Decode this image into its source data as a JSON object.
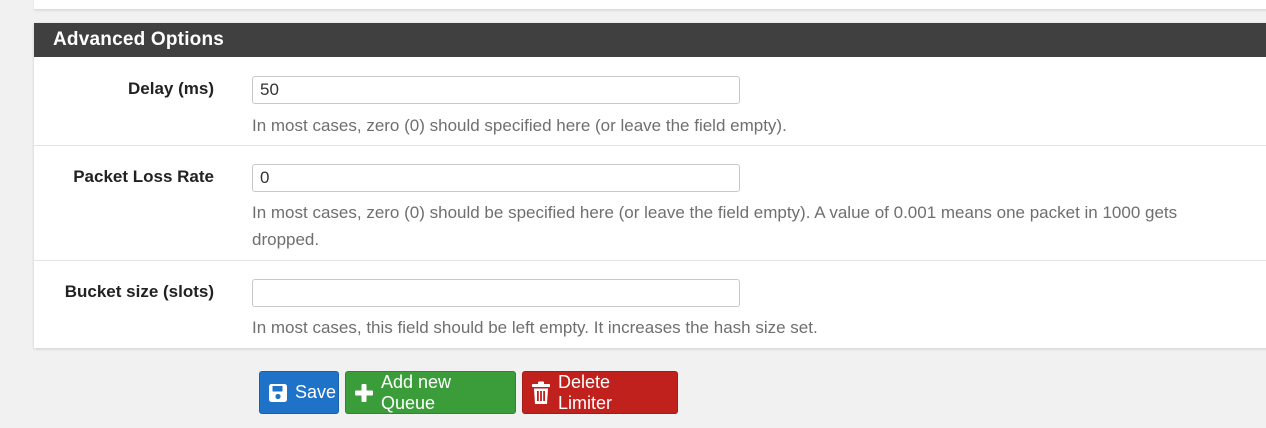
{
  "panel": {
    "title": "Advanced Options"
  },
  "fields": [
    {
      "label": "Delay (ms)",
      "value": "50",
      "help": "In most cases, zero (0) should specified here (or leave the field empty).",
      "help_line2": ""
    },
    {
      "label": "Packet Loss Rate",
      "value": "0",
      "help": "In most cases, zero (0) should be specified here (or leave the field empty). A value of 0.001 means one packet in 1000 gets",
      "help_line2": "dropped."
    },
    {
      "label": "Bucket size (slots)",
      "value": "",
      "help": "In most cases, this field should be left empty. It increases the hash size set.",
      "help_line2": ""
    }
  ],
  "buttons": {
    "save": "Save",
    "add_queue": "Add new Queue",
    "delete_limiter": "Delete Limiter"
  },
  "icons": {
    "save": "floppy-disk-icon",
    "add": "plus-icon",
    "delete": "trash-icon"
  },
  "colors": {
    "heading_bg": "#404040",
    "save": "#1e73c9",
    "add": "#3a9d3a",
    "delete": "#c0211c"
  }
}
